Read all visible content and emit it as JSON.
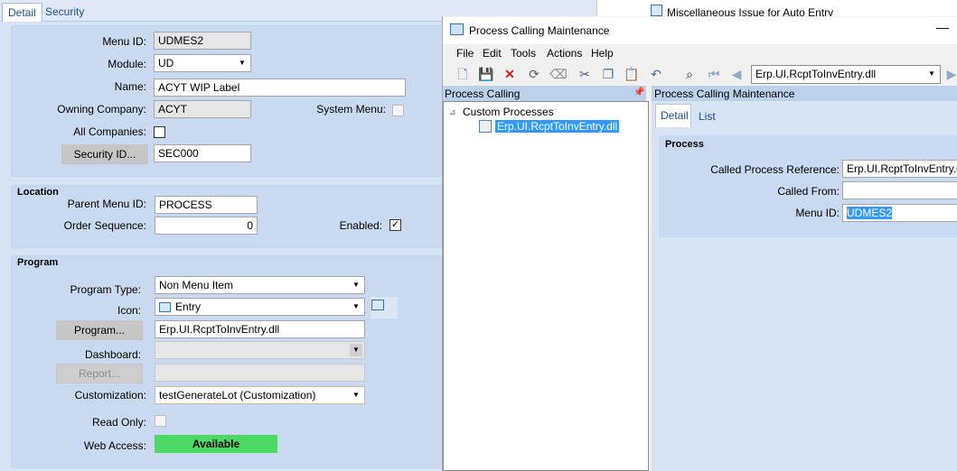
{
  "tabs": {
    "detail": "Detail",
    "security": "Security"
  },
  "form": {
    "menu_id_label": "Menu ID:",
    "menu_id": "UDMES2",
    "module_label": "Module:",
    "module": "UD",
    "name_label": "Name:",
    "name": "ACYT WIP Label",
    "owning_company_label": "Owning Company:",
    "owning_company": "ACYT",
    "system_menu_label": "System Menu:",
    "all_companies_label": "All Companies:",
    "security_id_button": "Security ID...",
    "security_id": "SEC000"
  },
  "location": {
    "title": "Location",
    "parent_menu_id_label": "Parent Menu ID:",
    "parent_menu_id": "PROCESS",
    "order_sequence_label": "Order Sequence:",
    "order_sequence": "0",
    "enabled_label": "Enabled:",
    "enabled_check": "✓"
  },
  "program": {
    "title": "Program",
    "program_type_label": "Program Type:",
    "program_type": "Non Menu Item",
    "icon_label": "Icon:",
    "icon": "Entry",
    "program_button": "Program...",
    "program": "Erp.UI.RcptToInvEntry.dll",
    "dashboard_label": "Dashboard:",
    "report_button": "Report...",
    "customization_label": "Customization:",
    "customization": "testGenerateLot (Customization)",
    "read_only_label": "Read Only:",
    "web_access_label": "Web Access:",
    "web_access": "Available"
  },
  "background_window": {
    "item": "Miscellaneous Issue for Auto Entry"
  },
  "dialog": {
    "title": "Process Calling Maintenance",
    "minimize": "—",
    "menu": [
      "File",
      "Edit",
      "Tools",
      "Actions",
      "Help"
    ],
    "toolbar_combo": "Erp.UI.RcptToInvEntry.dll",
    "left_header": "Process Calling",
    "tree_root": "Custom Processes",
    "tree_child": "Erp.UI.RcptToInvEntry.dll",
    "right_header": "Process Calling Maintenance",
    "tab_detail": "Detail",
    "tab_list": "List",
    "process_title": "Process",
    "called_process_label": "Called Process Reference:",
    "called_process": "Erp.UI.RcptToInvEntry.dll",
    "called_from_label": "Called From:",
    "called_from": "",
    "menu_id_label": "Menu ID:",
    "menu_id": "UDMES2"
  },
  "icons": [
    "new-icon",
    "save-icon",
    "delete-icon",
    "refresh-icon",
    "clear-icon",
    "cut-icon",
    "copy-icon",
    "paste-icon",
    "undo-icon",
    "search-icon",
    "first-icon",
    "prev-icon",
    "next-icon",
    "dropdown-arrow-icon",
    "pin-icon",
    "dll-icon"
  ],
  "colors": {
    "available": "#4cd964",
    "selection": "#3399ff",
    "panel": "#c9daf0"
  }
}
